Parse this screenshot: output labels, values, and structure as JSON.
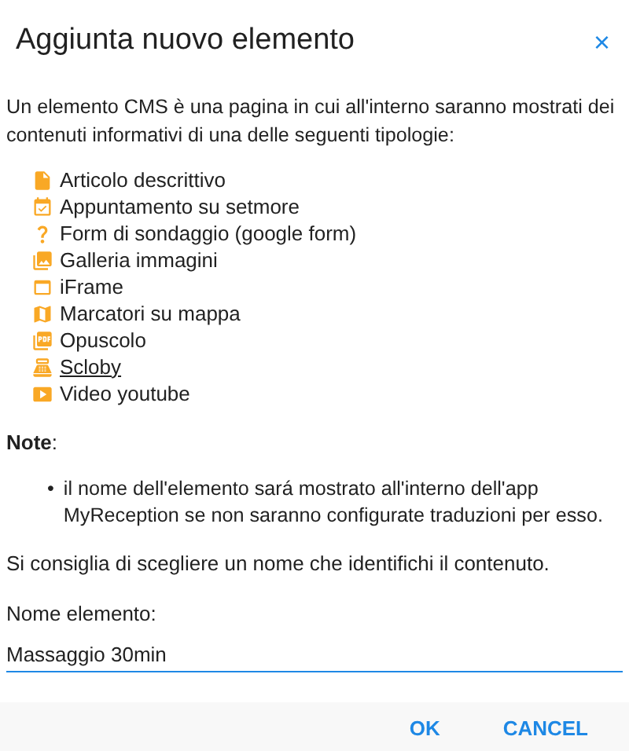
{
  "dialog": {
    "title": "Aggiunta nuovo elemento",
    "close": "×"
  },
  "intro": "Un elemento CMS è una pagina in cui all'interno saranno mostrati dei contenuti informativi di una delle seguenti tipologie:",
  "types": [
    {
      "kind": "file",
      "label": "Articolo descrittivo",
      "link": false
    },
    {
      "kind": "calendar",
      "label": "Appuntamento su setmore",
      "link": false
    },
    {
      "kind": "question",
      "label": "Form di sondaggio (google form)",
      "link": false
    },
    {
      "kind": "gallery",
      "label": "Galleria immagini",
      "link": false
    },
    {
      "kind": "frame",
      "label": "iFrame",
      "link": false
    },
    {
      "kind": "map",
      "label": "Marcatori su mappa",
      "link": false
    },
    {
      "kind": "pdf",
      "label": "Opuscolo",
      "link": false
    },
    {
      "kind": "register",
      "label": "Scloby",
      "link": true
    },
    {
      "kind": "video",
      "label": "Video youtube",
      "link": false
    }
  ],
  "note": {
    "heading": "Note",
    "colon": ":",
    "marker": "•",
    "bullets": [
      "il nome dell'elemento sará mostrato all'interno dell'app MyReception se non saranno configurate traduzioni per esso."
    ]
  },
  "advice": "Si consiglia di scegliere un nome che identifichi il contenuto.",
  "name_field": {
    "label": "Nome elemento:",
    "value": "Massaggio 30min"
  },
  "buttons": [
    "OK",
    "CANCEL"
  ]
}
